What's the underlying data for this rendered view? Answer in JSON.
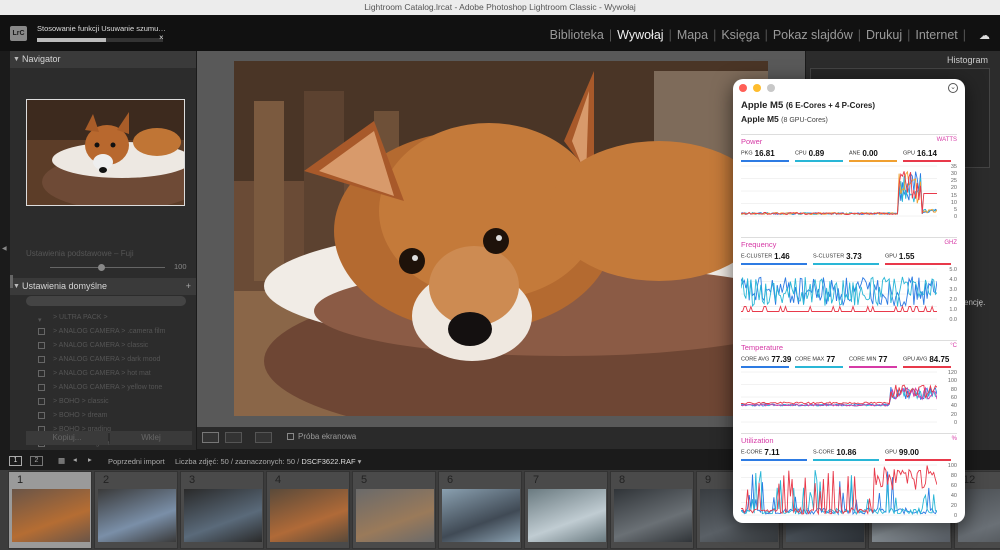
{
  "window": {
    "title": "Lightroom Catalog.lrcat - Adobe Photoshop Lightroom Classic - Wywołaj"
  },
  "topbar": {
    "logo": "LrC",
    "progress_label": "Stosowanie funkcji Usuwanie szumu…",
    "progress_value": 0.55,
    "progress_close": "×",
    "modules": [
      "Biblioteka",
      "Wywołaj",
      "Mapa",
      "Księga",
      "Pokaz slajdów",
      "Drukuj",
      "Internet"
    ],
    "active_module": "Wywołaj",
    "cloud_icon": "cloud-icon"
  },
  "left_panel": {
    "navigator_title": "Navigator",
    "soft_proof_label": "Ustawienia podstawowe – Fuji",
    "slider_value": "100",
    "presets_title": "Ustawienia domyślne",
    "presets": [
      "> ULTRA PACK >",
      "> ANALOG CAMERA > .camera film",
      "> ANALOG CAMERA > classic",
      "> ANALOG CAMERA > dark mood",
      "> ANALOG CAMERA > hot mat",
      "> ANALOG CAMERA > yellow tone",
      "> BOHO > classic",
      "> BOHO > dream",
      "> BOHO > grading",
      "> DIY > analog train"
    ],
    "copy_button": "Kopiuj...",
    "paste_button": "Wklej"
  },
  "toolbar": {
    "softproof_label": "Próba ekranowa"
  },
  "right_panel": {
    "histogram_title": "Histogram",
    "partial_text": "encję."
  },
  "filmstrip": {
    "page1": "1",
    "page2": "2",
    "source": "Poprzedni import",
    "info_prefix": "Liczba zdjęć: 50 / zaznaczonych: 50 /",
    "filename": "DSCF3622.RAF",
    "numbers": [
      "1",
      "2",
      "3",
      "4",
      "5",
      "6",
      "7",
      "8",
      "9",
      "10",
      "11",
      "12"
    ]
  },
  "monitor": {
    "chip": "Apple M5",
    "cores": "(6 E-Cores + 4 P-Cores)",
    "gpu_name": "Apple M5",
    "gpu_cores": "(8 GPU-Cores)",
    "colors": {
      "blue": "#2d7be3",
      "cyan": "#29b6d6",
      "red": "#e8394a",
      "orange": "#f0a030",
      "pink": "#d63aa6"
    },
    "sections": [
      {
        "key": "power",
        "title": "Power",
        "unit": "WATTS",
        "metrics": [
          {
            "label": "PKG",
            "value": "16.81",
            "color": "blue"
          },
          {
            "label": "CPU",
            "value": "0.89",
            "color": "cyan"
          },
          {
            "label": "ANE",
            "value": "0.00",
            "color": "orange"
          },
          {
            "label": "GPU",
            "value": "16.14",
            "color": "red"
          }
        ],
        "yticks": [
          "35",
          "30",
          "25",
          "20",
          "15",
          "10",
          "5",
          "0"
        ]
      },
      {
        "key": "frequency",
        "title": "Frequency",
        "unit": "GHZ",
        "metrics": [
          {
            "label": "E-CLUSTER",
            "value": "1.46",
            "color": "blue"
          },
          {
            "label": "S-CLUSTER",
            "value": "3.73",
            "color": "cyan"
          },
          {
            "label": "GPU",
            "value": "1.55",
            "color": "red"
          }
        ],
        "yticks": [
          "5.0",
          "4.0",
          "3.0",
          "2.0",
          "1.0",
          "0.0"
        ]
      },
      {
        "key": "temperature",
        "title": "Temperature",
        "unit": "°C",
        "metrics": [
          {
            "label": "CORE AVG",
            "value": "77.39",
            "color": "blue"
          },
          {
            "label": "CORE MAX",
            "value": "77",
            "color": "cyan"
          },
          {
            "label": "CORE MIN",
            "value": "77",
            "color": "pink"
          },
          {
            "label": "GPU AVG",
            "value": "84.75",
            "color": "red"
          }
        ],
        "yticks": [
          "120",
          "100",
          "80",
          "60",
          "40",
          "20",
          "0"
        ]
      },
      {
        "key": "utilization",
        "title": "Utilization",
        "unit": "%",
        "metrics": [
          {
            "label": "E-CORE",
            "value": "7.11",
            "color": "blue"
          },
          {
            "label": "S-CORE",
            "value": "10.86",
            "color": "cyan"
          },
          {
            "label": "GPU",
            "value": "99.00",
            "color": "red"
          }
        ],
        "yticks": [
          "100",
          "80",
          "60",
          "40",
          "20",
          "0"
        ]
      }
    ]
  }
}
